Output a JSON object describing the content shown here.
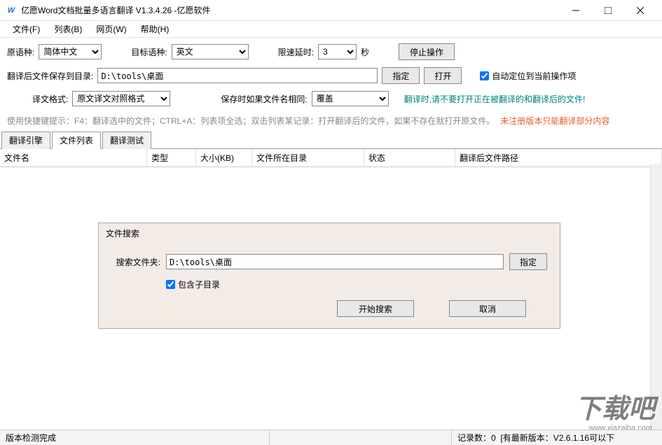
{
  "title": "亿愿Word文档批量多语言翻译 V1.3.4.26 -亿愿软件",
  "menu": {
    "file": "文件(F)",
    "list": "列表(B)",
    "web": "网页(W)",
    "help": "帮助(H)"
  },
  "toolbar": {
    "source_lang_label": "原语种:",
    "source_lang_value": "简体中文",
    "target_lang_label": "目标语种:",
    "target_lang_value": "英文",
    "rate_limit_label": "限速延时:",
    "rate_limit_value": "3",
    "rate_limit_unit": "秒",
    "stop_btn": "停止操作",
    "save_dir_label": "翻译后文件保存到目录:",
    "save_dir_value": "D:\\tools\\桌面",
    "specify_btn": "指定",
    "open_btn": "打开",
    "auto_locate_label": "自动定位到当前操作项",
    "format_label": "译文格式:",
    "format_value": "原文译文对照格式",
    "same_name_label": "保存时如果文件名相同:",
    "same_name_value": "覆盖",
    "translate_warning": "翻译时,请不要打开正在被翻译的和翻译后的文件!",
    "shortcut_hint": "使用快捷键提示：F4：翻译选中的文件；CTRL+A：列表项全选；双击列表某记录：打开翻译后的文件，如果不存在就打开原文件。",
    "unregistered_hint": "未注册版本只能翻译部分内容"
  },
  "tabs": {
    "engine": "翻译引擎",
    "filelist": "文件列表",
    "test": "翻译测试"
  },
  "table": {
    "col_filename": "文件名",
    "col_type": "类型",
    "col_size": "大小(KB)",
    "col_dir": "文件所在目录",
    "col_status": "状态",
    "col_output": "翻译后文件路径"
  },
  "dialog": {
    "title": "文件搜索",
    "folder_label": "搜索文件夹:",
    "folder_value": "D:\\tools\\桌面",
    "specify_btn": "指定",
    "include_sub_label": "包含子目录",
    "start_btn": "开始搜索",
    "cancel_btn": "取消"
  },
  "statusbar": {
    "version_check": "版本检测完成",
    "record_count_label": "记录数：",
    "record_count_value": "0",
    "update_info": "[有最新版本：V2.6.1.16可以下"
  },
  "watermark": {
    "main": "下载吧",
    "sub": "www.xiazaiba.com"
  }
}
